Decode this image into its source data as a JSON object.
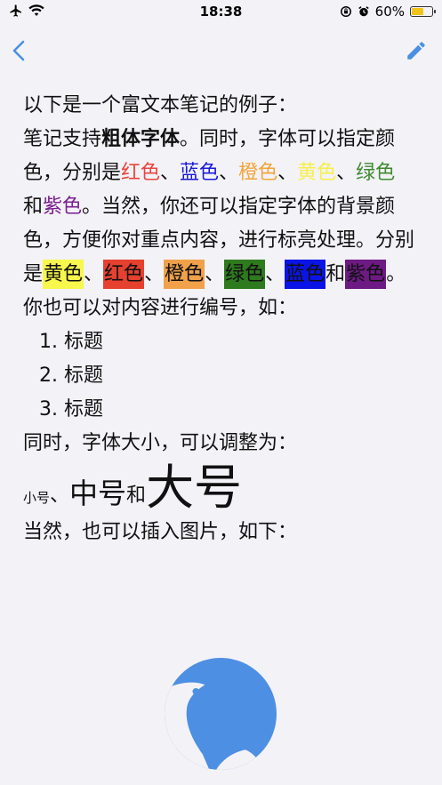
{
  "status_bar": {
    "time": "18:38",
    "battery_percent": "60%",
    "battery_level": 0.6,
    "icons": [
      "airplane-icon",
      "wifi-icon",
      "orientation-lock-icon",
      "alarm-icon",
      "battery-icon"
    ]
  },
  "nav": {
    "back_icon": "chevron-left-icon",
    "edit_icon": "pencil-icon",
    "accent_color": "#4a90e2"
  },
  "note": {
    "intro": "以下是一个富文本笔记的例子：",
    "p1": {
      "t1": "笔记支持",
      "bold": "粗体字体",
      "t2": "。同时，字体可以指定颜色，分别是",
      "red": "红色",
      "sep1": "、",
      "blue": "蓝色",
      "sep2": "、",
      "orange": "橙色",
      "sep3": "、",
      "yellow": "黄色",
      "sep4": "、",
      "green": "绿色",
      "and": "和",
      "purple": "紫色",
      "t3": "。当然，你还可以指定字体的背景颜色，方便你对重点内容，进行标亮处理。分别是",
      "bg_yellow": "黄色",
      "bsep1": "、",
      "bg_red": "红色",
      "bsep2": "、",
      "bg_orange": "橙色",
      "bsep3": "、",
      "bg_green": "绿色",
      "bsep4": "、",
      "bg_blue": "蓝色",
      "band": "和",
      "bg_purple": "紫色",
      "end": "。"
    },
    "numbering_intro": "你也可以对内容进行编号，如：",
    "list": [
      "1. 标题",
      "2. 标题",
      "3. 标题"
    ],
    "size_intro": "同时，字体大小，可以调整为：",
    "sizes": {
      "small": "小号",
      "sep": "、",
      "mid": "中号",
      "and": "和",
      "large": "大号"
    },
    "image_intro": "当然，也可以插入图片，如下：",
    "text_colors": {
      "red": "#e8453c",
      "blue": "#1a1adb",
      "orange": "#f2a53a",
      "yellow": "#f5f04a",
      "green": "#3f8a2f",
      "purple": "#7b1e8f"
    },
    "bg_colors": {
      "yellow": "#f8f74b",
      "red": "#e6402f",
      "orange": "#f0a14a",
      "green": "#2e7a1f",
      "blue": "#0b14e6",
      "purple": "#6e1a85"
    },
    "image_icon": "polar-bear-logo-icon"
  }
}
